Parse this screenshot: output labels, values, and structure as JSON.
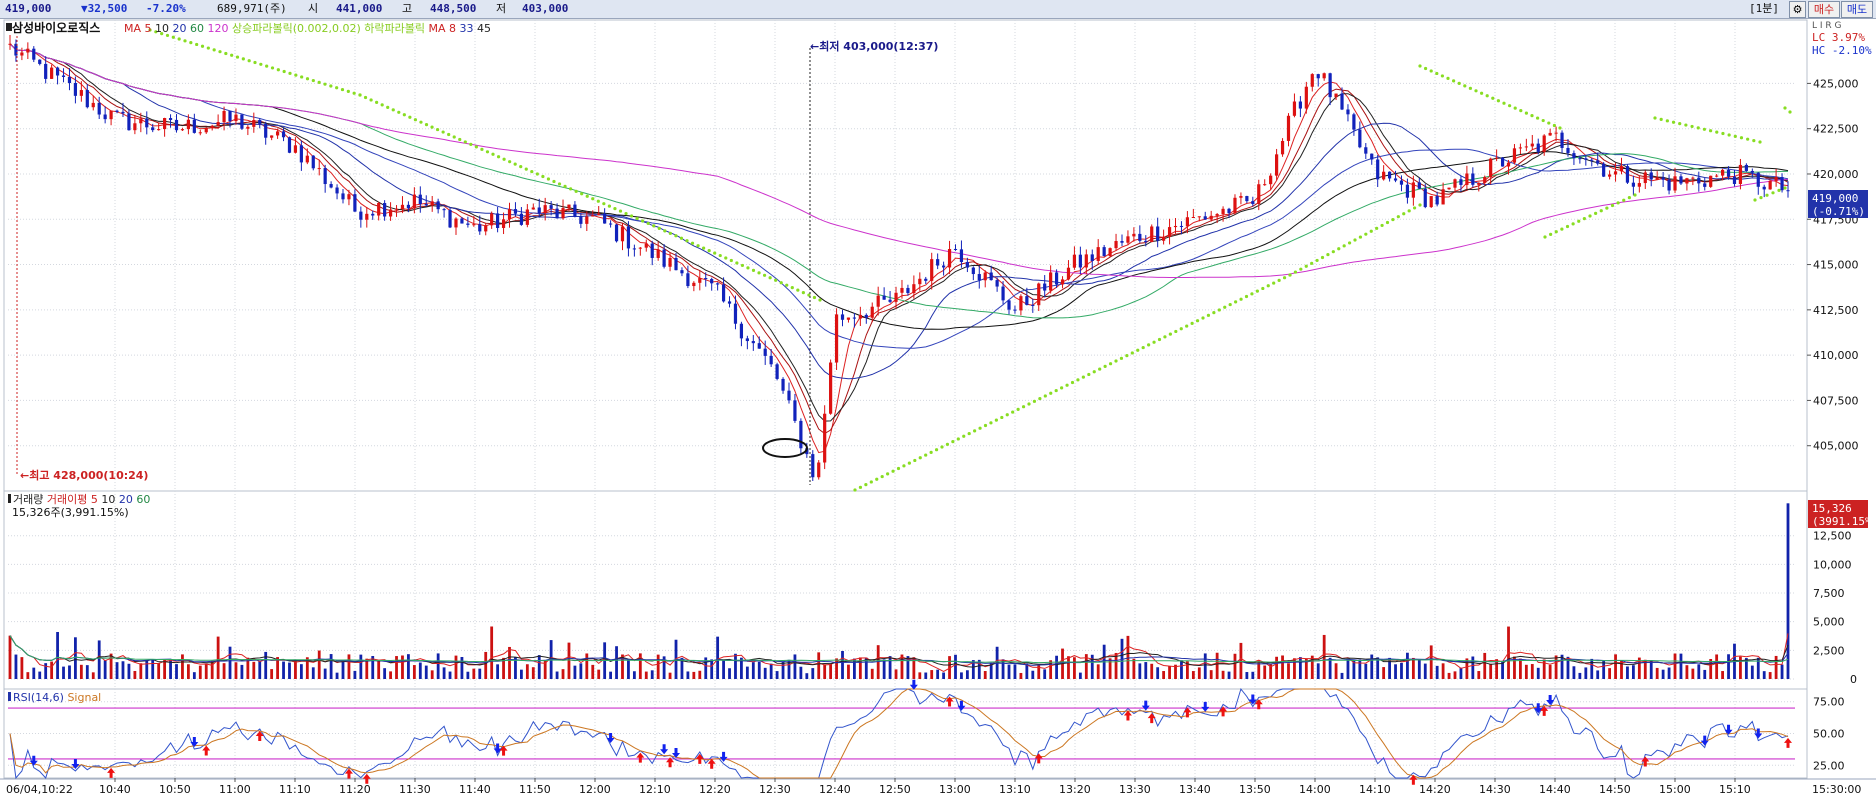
{
  "quote_bar": {
    "price": "419,000",
    "change": "▼32,500",
    "change_pct": "-7.20%",
    "volume": "689,971(주)",
    "open_label": "시",
    "open": "441,000",
    "high_label": "고",
    "high": "448,500",
    "low_label": "저",
    "low": "403,000",
    "interval": "[1분]",
    "settings_icon": "gear-icon",
    "buy_label": "매수",
    "sell_label": "매도"
  },
  "price_panel": {
    "title": "삼성바이오로직스",
    "legend": [
      {
        "text": "MA",
        "color": "#cc2222"
      },
      {
        "text": "5",
        "color": "#cc2222"
      },
      {
        "text": "10",
        "color": "#222222"
      },
      {
        "text": "20",
        "color": "#2233aa"
      },
      {
        "text": "60",
        "color": "#228844"
      },
      {
        "text": "120",
        "color": "#cc33cc"
      },
      {
        "text": "상승파라볼릭(0.002,0.02)",
        "color": "#88cc22"
      },
      {
        "text": "하락파라볼릭",
        "color": "#88cc22"
      },
      {
        "text": "MA",
        "color": "#cc2222"
      },
      {
        "text": "8",
        "color": "#cc2222"
      },
      {
        "text": "33",
        "color": "#2233aa"
      },
      {
        "text": "45",
        "color": "#222222"
      }
    ],
    "high_annotation": "최고 428,000(10:24)",
    "low_annotation": "최저 403,000(12:37)",
    "lc_label": "LC 3.97%",
    "hc_label": "HC -2.10%",
    "corner_label": "L I R G",
    "current_price": "419,000",
    "current_change": "(-0.71%)"
  },
  "volume_panel": {
    "legend": [
      {
        "text": "거래량",
        "color": "#222222"
      },
      {
        "text": "거래이평",
        "color": "#cc2222"
      },
      {
        "text": "5",
        "color": "#cc2222"
      },
      {
        "text": "10",
        "color": "#222222"
      },
      {
        "text": "20",
        "color": "#2233aa"
      },
      {
        "text": "60",
        "color": "#228844"
      }
    ],
    "current_text": "15,326주(3,991.15%)",
    "current_tag": "15,326",
    "current_tag2": "(3991.15%)"
  },
  "rsi_panel": {
    "legend": [
      {
        "text": "RSI(14,6)",
        "color": "#2233aa"
      },
      {
        "text": "Signal",
        "color": "#cc7722"
      }
    ]
  },
  "chart_data": [
    {
      "type": "line",
      "name": "price",
      "x": [
        "10:22",
        "10:40",
        "10:50",
        "11:00",
        "11:10",
        "11:20",
        "11:30",
        "11:40",
        "11:50",
        "12:00",
        "12:10",
        "12:20",
        "12:30",
        "12:37",
        "12:40",
        "12:50",
        "13:00",
        "13:10",
        "13:20",
        "13:30",
        "13:40",
        "13:50",
        "14:00",
        "14:10",
        "14:20",
        "14:30",
        "14:40",
        "14:50",
        "15:00",
        "15:10",
        "15:20"
      ],
      "values": [
        427000,
        423000,
        422500,
        423000,
        421500,
        418000,
        418500,
        417000,
        418000,
        417500,
        415500,
        413500,
        409000,
        403000,
        412000,
        413000,
        416000,
        412500,
        415000,
        416500,
        417500,
        418500,
        426000,
        420000,
        418500,
        420500,
        422000,
        420000,
        419500,
        420000,
        419000
      ],
      "ylim": [
        403000,
        428000
      ],
      "yticks": [
        405000,
        407500,
        410000,
        412500,
        415000,
        417500,
        420000,
        422500,
        425000
      ],
      "ytick_labels": [
        "405,000",
        "407,500",
        "410,000",
        "412,500",
        "415,000",
        "417,500",
        "420,000",
        "422,500",
        "425,000"
      ],
      "xtick_labels": [
        "06/04,10:22",
        "10:40",
        "10:50",
        "11:00",
        "11:10",
        "11:20",
        "11:30",
        "11:40",
        "11:50",
        "12:00",
        "12:10",
        "12:20",
        "12:30",
        "12:40",
        "12:50",
        "13:00",
        "13:10",
        "13:20",
        "13:30",
        "13:40",
        "13:50",
        "14:00",
        "14:10",
        "14:20",
        "14:30",
        "14:40",
        "14:50",
        "15:00",
        "15:10",
        "15:30:00"
      ]
    },
    {
      "type": "bar",
      "name": "volume",
      "ylim": [
        0,
        15326
      ],
      "yticks": [
        0,
        2500,
        5000,
        7500,
        10000,
        12500
      ],
      "ytick_labels": [
        "0",
        "2,500",
        "5,000",
        "7,500",
        "10,000",
        "12,500"
      ],
      "last_value": 15326
    },
    {
      "type": "line",
      "name": "rsi",
      "ylim": [
        15,
        85
      ],
      "yticks": [
        25,
        50,
        75
      ],
      "ytick_labels": [
        "25.00",
        "50.00",
        "75.00"
      ],
      "bands": [
        30,
        70
      ]
    }
  ]
}
